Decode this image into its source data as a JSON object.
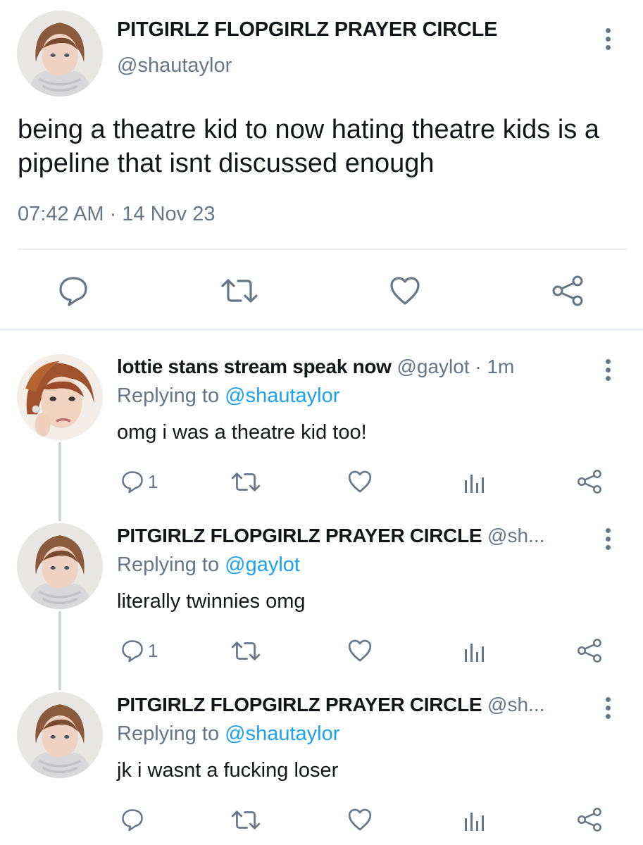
{
  "main_tweet": {
    "name": "PITGIRLZ FLOPGIRLZ PRAYER CIRCLE",
    "handle": "@shautaylor",
    "text": "being a theatre kid to now hating theatre kids is a pipeline that isnt discussed enough",
    "timestamp": "07:42 AM · 14 Nov 23",
    "avatar_icon": "profile-photo",
    "actions": [
      "reply-icon",
      "retweet-icon",
      "like-icon",
      "share-icon"
    ]
  },
  "replies": [
    {
      "name": "lottie stans stream speak now",
      "meta": " @gaylot · 1m",
      "replying_prefix": "Replying to ",
      "replying_to": "@shautaylor",
      "text": "omg i was a theatre kid too!",
      "reply_count": "1",
      "avatar_icon": "profile-photo"
    },
    {
      "name": "PITGIRLZ FLOPGIRLZ PRAYER CIRCLE",
      "meta": " @sh...",
      "replying_prefix": "Replying to ",
      "replying_to": "@gaylot",
      "text": "literally twinnies omg",
      "reply_count": "1",
      "avatar_icon": "profile-photo"
    },
    {
      "name": "PITGIRLZ FLOPGIRLZ PRAYER CIRCLE",
      "meta": " @sh...",
      "replying_prefix": "Replying to ",
      "replying_to": "@shautaylor",
      "text": "jk i wasnt a fucking loser",
      "reply_count": "",
      "avatar_icon": "profile-photo"
    }
  ],
  "colors": {
    "text": "#14171a",
    "secondary": "#657786",
    "mention": "#1da1f2",
    "divider": "#e6ecf0",
    "thread_line": "#ccd6dd"
  }
}
